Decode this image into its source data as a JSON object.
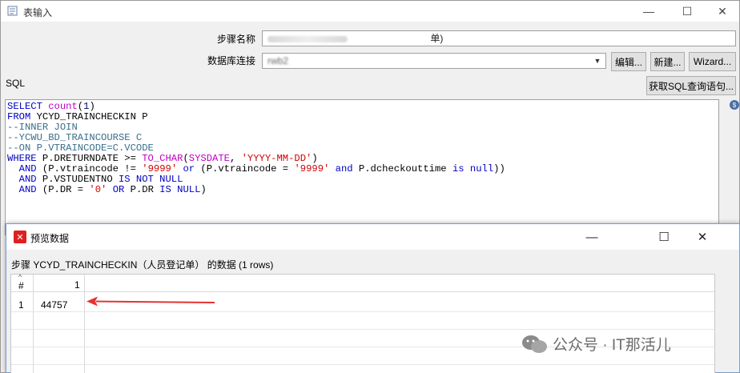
{
  "window": {
    "title": "表输入",
    "minimize": "—",
    "maximize": "☐",
    "close": "✕"
  },
  "form": {
    "step_name_label": "步骤名称",
    "step_name_value_tail": "单)",
    "db_conn_label": "数据库连接",
    "db_conn_value": "rwb2",
    "edit_button": "编辑...",
    "new_button": "新建...",
    "wizard_button": "Wizard...",
    "sql_label": "SQL",
    "get_sql_button": "获取SQL查询语句..."
  },
  "sql": {
    "lines": [
      [
        {
          "t": "SELECT ",
          "c": "kw"
        },
        {
          "t": "count",
          "c": "fn"
        },
        {
          "t": "(",
          "c": ""
        },
        {
          "t": "1",
          "c": "nm"
        },
        {
          "t": ")",
          "c": ""
        }
      ],
      [
        {
          "t": "FROM ",
          "c": "kw"
        },
        {
          "t": "YCYD_TRAINCHECKIN P",
          "c": ""
        }
      ],
      [
        {
          "t": "--INNER JOIN",
          "c": "cm"
        }
      ],
      [
        {
          "t": "--YCWU_BD_TRAINCOURSE C",
          "c": "cm"
        }
      ],
      [
        {
          "t": "--ON P.VTRAINCODE=C.VCODE",
          "c": "cm"
        }
      ],
      [
        {
          "t": "WHERE ",
          "c": "kw"
        },
        {
          "t": "P.DRETURNDATE >= ",
          "c": ""
        },
        {
          "t": "TO_CHAR",
          "c": "fn"
        },
        {
          "t": "(",
          "c": ""
        },
        {
          "t": "SYSDATE",
          "c": "fn"
        },
        {
          "t": ", ",
          "c": ""
        },
        {
          "t": "'YYYY-MM-DD'",
          "c": "str"
        },
        {
          "t": ")",
          "c": ""
        }
      ],
      [
        {
          "t": "  ",
          "c": ""
        },
        {
          "t": "AND ",
          "c": "kw"
        },
        {
          "t": "(P.vtraincode != ",
          "c": ""
        },
        {
          "t": "'9999'",
          "c": "str"
        },
        {
          "t": " or ",
          "c": "kw"
        },
        {
          "t": "(P.vtraincode = ",
          "c": ""
        },
        {
          "t": "'9999'",
          "c": "str"
        },
        {
          "t": " and ",
          "c": "kw"
        },
        {
          "t": "P.dcheckouttime ",
          "c": ""
        },
        {
          "t": "is null",
          "c": "kw"
        },
        {
          "t": "))",
          "c": ""
        }
      ],
      [
        {
          "t": "  ",
          "c": ""
        },
        {
          "t": "AND ",
          "c": "kw"
        },
        {
          "t": "P.VSTUDENTNO ",
          "c": ""
        },
        {
          "t": "IS NOT NULL",
          "c": "kw"
        }
      ],
      [
        {
          "t": "  ",
          "c": ""
        },
        {
          "t": "AND ",
          "c": "kw"
        },
        {
          "t": "(P.DR = ",
          "c": ""
        },
        {
          "t": "'0'",
          "c": "str"
        },
        {
          "t": " OR ",
          "c": "kw"
        },
        {
          "t": "P.DR ",
          "c": ""
        },
        {
          "t": "IS NULL",
          "c": "kw"
        },
        {
          "t": ")",
          "c": ""
        }
      ]
    ]
  },
  "preview": {
    "title": "预览数据",
    "minimize": "—",
    "maximize": "☐",
    "close": "✕",
    "step_line": "步骤 YCYD_TRAINCHECKIN（人员登记单） 的数据  (1 rows)",
    "grid": {
      "headers": [
        "#",
        "1"
      ],
      "rows": [
        [
          "1",
          "44757"
        ]
      ]
    }
  },
  "watermark": "公众号 · IT那活儿"
}
